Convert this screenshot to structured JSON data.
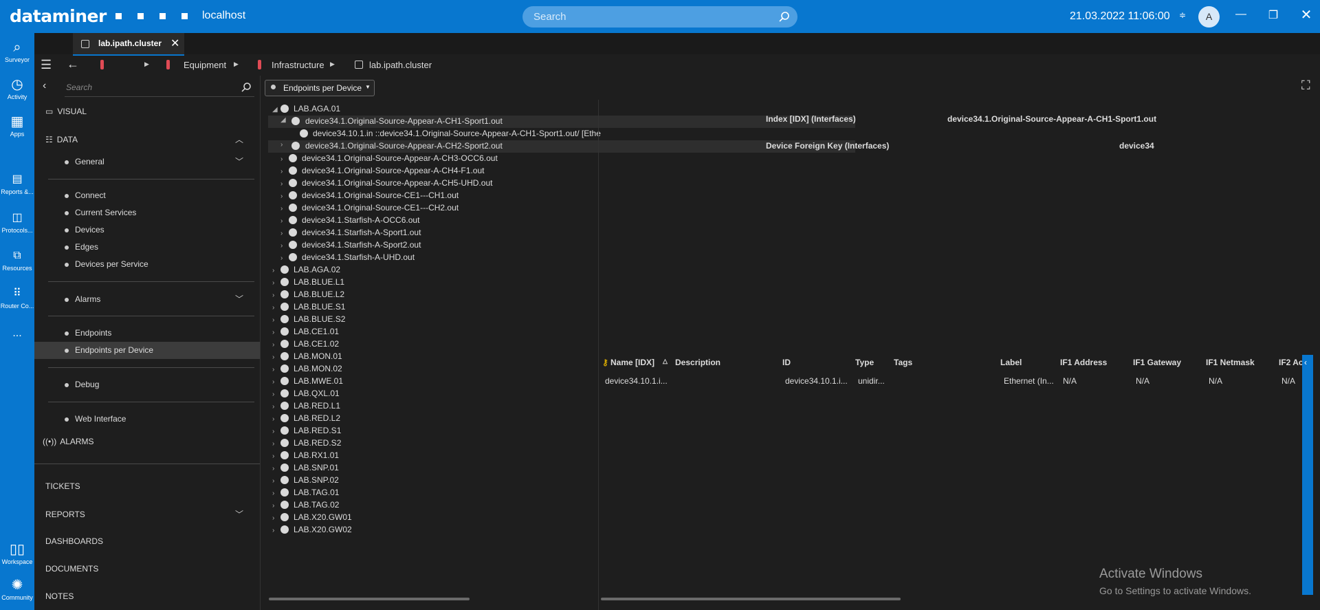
{
  "topbar": {
    "logo": "dataminer",
    "host": "localhost",
    "search_placeholder": "Search",
    "datetime": "21.03.2022 11:06:00",
    "avatar_initial": "A",
    "accent": "#0877cf"
  },
  "leftnav": {
    "items": [
      {
        "label": "Surveyor",
        "icon": "surveyor-icon"
      },
      {
        "label": "Activity",
        "icon": "clock-icon"
      },
      {
        "label": "Apps",
        "icon": "apps-grid-icon"
      },
      {
        "label": "Reports &...",
        "icon": "reports-icon"
      },
      {
        "label": "Protocols...",
        "icon": "protocols-icon"
      },
      {
        "label": "Resources",
        "icon": "resources-icon"
      },
      {
        "label": "Router Co...",
        "icon": "router-grid-icon"
      },
      {
        "label": "...",
        "icon": "more-icon"
      },
      {
        "label": "Workspace",
        "icon": "workspace-icon"
      },
      {
        "label": "Community",
        "icon": "community-icon"
      }
    ]
  },
  "tab": {
    "label": "lab.ipath.cluster"
  },
  "breadcrumb": {
    "items": [
      "Equipment",
      "Infrastructure",
      "lab.ipath.cluster"
    ]
  },
  "sidebar": {
    "search_placeholder": "Search",
    "sections": {
      "visual": "VISUAL",
      "data": "DATA",
      "alarms": "ALARMS",
      "tickets": "TICKETS",
      "reports": "REPORTS",
      "dashboards": "DASHBOARDS",
      "documents": "DOCUMENTS",
      "notes": "NOTES"
    },
    "groups": {
      "general": "General",
      "alarms": "Alarms"
    },
    "items": {
      "connect": "Connect",
      "current_services": "Current Services",
      "devices": "Devices",
      "edges": "Edges",
      "devices_per_service": "Devices per Service",
      "endpoints": "Endpoints",
      "endpoints_per_device": "Endpoints per Device",
      "debug": "Debug",
      "web_interface": "Web Interface"
    }
  },
  "toolbar": {
    "dropdown_value": "Endpoints per Device"
  },
  "tree": {
    "root_open": "LAB.AGA.01",
    "children": [
      "device34.1.Original-Source-Appear-A-CH1-Sport1.out",
      "device34.1.Original-Source-Appear-A-CH2-Sport2.out",
      "device34.1.Original-Source-Appear-A-CH3-OCC6.out",
      "device34.1.Original-Source-Appear-A-CH4-F1.out",
      "device34.1.Original-Source-Appear-A-CH5-UHD.out",
      "device34.1.Original-Source-CE1---CH1.out",
      "device34.1.Original-Source-CE1---CH2.out",
      "device34.1.Starfish-A-OCC6.out",
      "device34.1.Starfish-A-Sport1.out",
      "device34.1.Starfish-A-Sport2.out",
      "device34.1.Starfish-A-UHD.out"
    ],
    "grandchild": "device34.10.1.in ::device34.1.Original-Source-Appear-A-CH1-Sport1.out/ [Ethe",
    "roots": [
      "LAB.AGA.02",
      "LAB.BLUE.L1",
      "LAB.BLUE.L2",
      "LAB.BLUE.S1",
      "LAB.BLUE.S2",
      "LAB.CE1.01",
      "LAB.CE1.02",
      "LAB.MON.01",
      "LAB.MON.02",
      "LAB.MWE.01",
      "LAB.QXL.01",
      "LAB.RED.L1",
      "LAB.RED.L2",
      "LAB.RED.S1",
      "LAB.RED.S2",
      "LAB.RX1.01",
      "LAB.SNP.01",
      "LAB.SNP.02",
      "LAB.TAG.01",
      "LAB.TAG.02",
      "LAB.X20.GW01",
      "LAB.X20.GW02"
    ]
  },
  "details": {
    "index_label": "Index [IDX] (Interfaces)",
    "index_value": "device34.1.Original-Source-Appear-A-CH1-Sport1.out",
    "fk_label": "Device Foreign Key (Interfaces)",
    "fk_value": "device34"
  },
  "grid": {
    "headers": [
      "Name [IDX]",
      "Description",
      "ID",
      "Type",
      "Tags",
      "Label",
      "IF1 Address",
      "IF1 Gateway",
      "IF1 Netmask",
      "IF2 Ac"
    ],
    "row": [
      "device34.10.1.i...",
      "",
      "device34.10.1.i...",
      "unidir...",
      "",
      "Ethernet (In...",
      "N/A",
      "N/A",
      "N/A",
      "N/A"
    ]
  },
  "watermark": {
    "line1": "Activate Windows",
    "line2": "Go to Settings to activate Windows."
  }
}
